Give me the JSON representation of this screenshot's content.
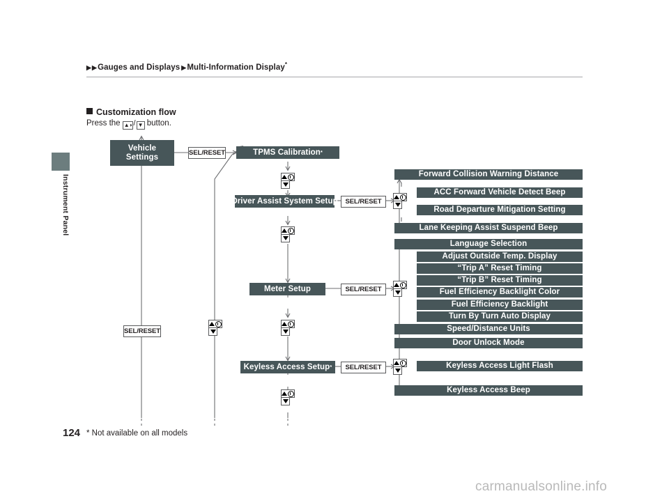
{
  "breadcrumb": {
    "item1": "Gauges and Displays",
    "item2": "Multi-Information Display",
    "asterisk": "*",
    "arrow_glyph": "▶"
  },
  "sidebar": {
    "tab_label": "Instrument Panel",
    "tab_color": "#6c7d7e"
  },
  "section": {
    "heading": "Customization flow",
    "instruction_prefix": "Press the",
    "instruction_suffix": "button.",
    "up_button_icon": "up-info-button-icon",
    "down_button_icon": "down-button-icon",
    "separator": "/"
  },
  "footer": {
    "page_number": "124",
    "footnote": "* Not available on all models",
    "watermark": "carmanualsonline.info"
  },
  "colors": {
    "box_fill": "#475659",
    "box_text": "#ffffff",
    "tab": "#6c7d7e",
    "line": "#6d6e71"
  },
  "diagram": {
    "root": {
      "label_line1": "Vehicle",
      "label_line2": "Settings"
    },
    "sel_reset_label": "SEL/RESET",
    "menus": [
      {
        "name": "tpms-calibration",
        "label": "TPMS Calibration",
        "asterisk": "*",
        "has_sel_reset": true,
        "children": []
      },
      {
        "name": "driver-assist-system-setup",
        "label": "Driver Assist System Setup",
        "asterisk": "",
        "has_sel_reset": true,
        "children": [
          "Forward Collision Warning Distance",
          "ACC Forward Vehicle Detect Beep",
          "Road Departure Mitigation Setting",
          "Lane Keeping Assist Suspend Beep"
        ]
      },
      {
        "name": "meter-setup",
        "label": "Meter Setup",
        "asterisk": "",
        "has_sel_reset": true,
        "children": [
          "Language Selection",
          "Adjust Outside Temp. Display",
          "“Trip A” Reset Timing",
          "“Trip B” Reset Timing",
          "Fuel Efficiency Backlight Color",
          "Fuel Efficiency Backlight",
          "Turn By Turn Auto Display",
          "Speed/Distance Units",
          "Door Unlock Mode"
        ]
      },
      {
        "name": "keyless-access-setup",
        "label": "Keyless Access Setup",
        "asterisk": "*",
        "has_sel_reset": true,
        "children": [
          "Keyless Access Light Flash",
          "Keyless Access Beep"
        ]
      }
    ]
  }
}
